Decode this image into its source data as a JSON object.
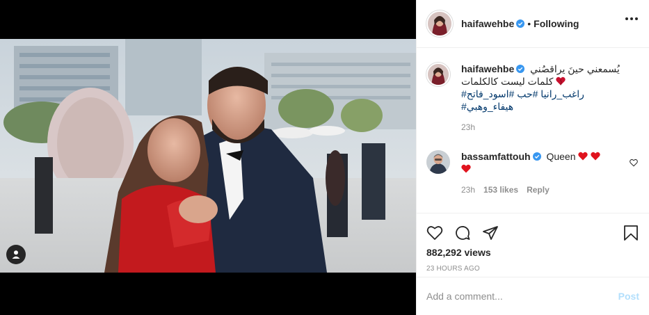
{
  "post": {
    "author": "haifawehbe",
    "follow_separator": "•",
    "follow_status": "Following",
    "caption_line1": "يُسمعني حينَ يراقصُني",
    "caption_line2": "كلمات ليست كالكلمات",
    "caption_hashtags1": "راغب_رانيا #حب #اسود_فاتح#",
    "caption_hashtags2": "#هيفاء_وهبي",
    "caption_time": "23h",
    "views": "882,292 views",
    "date": "23 HOURS AGO"
  },
  "comment": {
    "author": "bassamfattouh",
    "text": "Queen",
    "time": "23h",
    "likes": "153 likes",
    "reply": "Reply"
  },
  "add_comment": {
    "placeholder": "Add a comment...",
    "post_label": "Post"
  },
  "icons": {
    "user_tag": "user-tag-icon",
    "more": "more-options-icon",
    "verified": "verified-badge-icon",
    "heart": "heart-icon",
    "comment": "comment-icon",
    "share": "share-icon",
    "save": "bookmark-icon"
  },
  "colors": {
    "verified_blue": "#3897f0",
    "heart_red": "#ed4956",
    "hashtag": "#00376b",
    "post_disabled": "#b2dffc",
    "muted": "#8e8e8e"
  }
}
